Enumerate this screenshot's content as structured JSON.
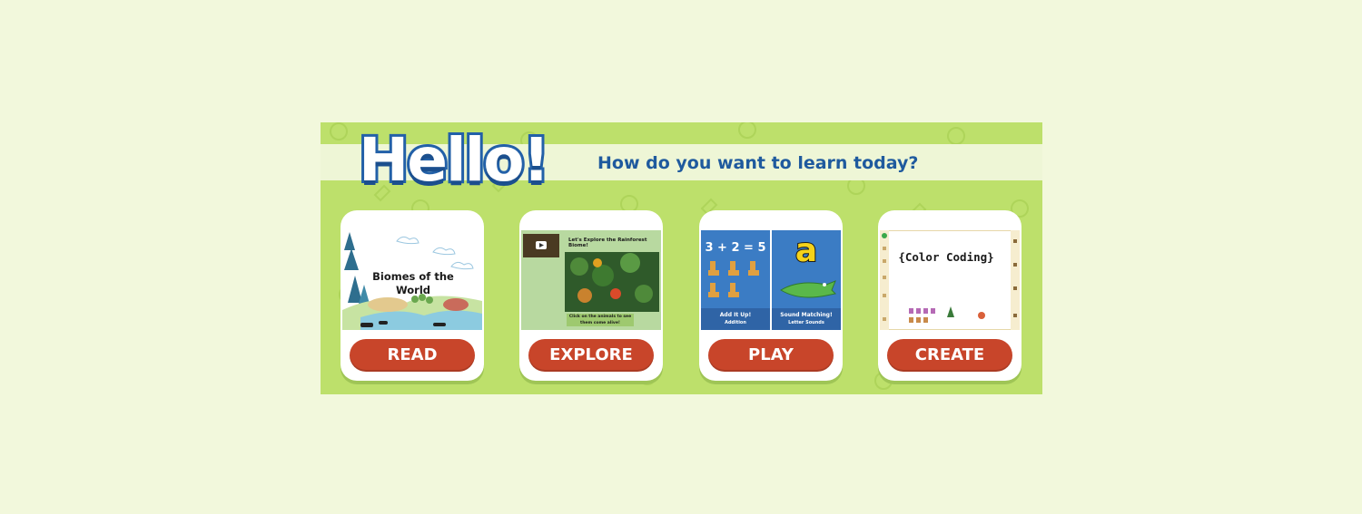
{
  "header": {
    "greeting": "Hello!",
    "subtitle": "How do you want to learn today?"
  },
  "cards": [
    {
      "id": "read",
      "button_label": "READ",
      "thumbnail": {
        "title": "Biomes of the World"
      }
    },
    {
      "id": "explore",
      "button_label": "EXPLORE",
      "thumbnail": {
        "title": "Let's Explore the Rainforest Biome!",
        "caption": "Click on the animals to see them come alive!"
      }
    },
    {
      "id": "play",
      "button_label": "PLAY",
      "thumbnail": {
        "left": {
          "equation": "3 + 2 = 5",
          "label": "Add It Up!",
          "sublabel": "Addition"
        },
        "right": {
          "letter": "a",
          "label": "Sound Matching!",
          "sublabel": "Letter Sounds"
        }
      }
    },
    {
      "id": "create",
      "button_label": "CREATE",
      "thumbnail": {
        "title": "{Color Coding}"
      }
    }
  ],
  "colors": {
    "page_bg": "#f2f8dc",
    "banner_bg": "#bde06b",
    "button_bg": "#c8452a",
    "title_blue": "#1f5a9e"
  }
}
